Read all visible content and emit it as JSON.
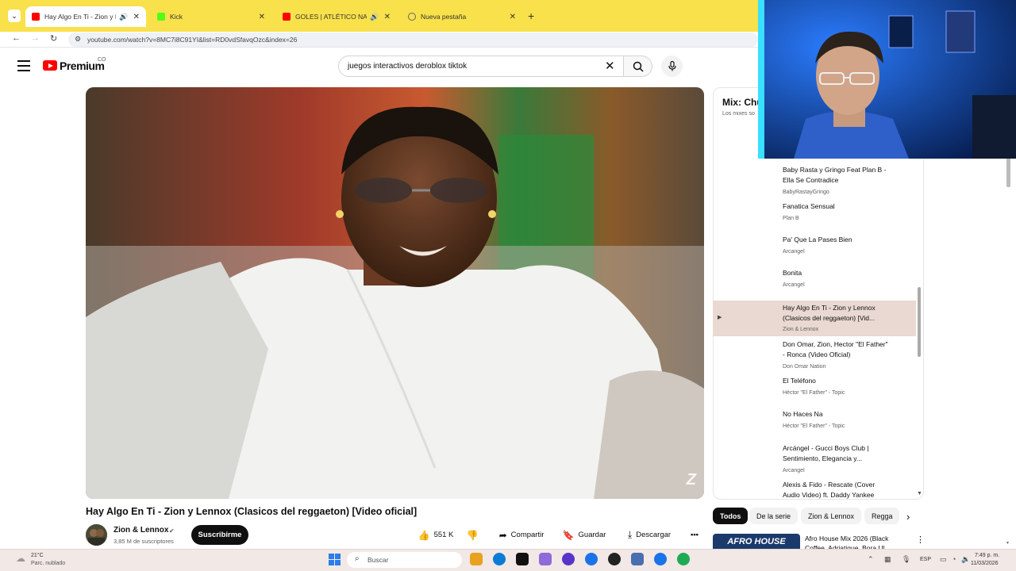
{
  "browser": {
    "tabs": [
      {
        "title": "Hay Algo En Ti - Zion y Len",
        "active": true,
        "favicon_color": "#ff0000"
      },
      {
        "title": "Kick",
        "active": false,
        "favicon_color": "#53fc18"
      },
      {
        "title": "GOLES | ATLÉTICO NACION",
        "active": false,
        "favicon_color": "#ff0000"
      },
      {
        "title": "Nueva pestaña",
        "active": false
      }
    ],
    "url": "youtube.com/watch?v=8MC7i8C91YI&list=RD0vdSfavqOzc&index=26"
  },
  "youtube": {
    "brand": "Premium",
    "country": "CO",
    "search_query": "juegos interactivos deroblox  tiktok"
  },
  "video": {
    "title": "Hay Algo En Ti - Zion y Lennox (Clasicos del reggaeton) [Video oficial]",
    "channel": "Zion & Lennox",
    "subscribers": "3,85 M de suscriptores",
    "subscribe_label": "Suscribirme",
    "likes": "551 K",
    "share_label": "Compartir",
    "save_label": "Guardar",
    "download_label": "Descargar"
  },
  "mix": {
    "title": "Mix: Chu",
    "subtitle": "Los mixes so"
  },
  "playlist": [
    {
      "title": "Baby Rasta y Gringo Feat Plan B - Ella Se Contradice",
      "channel": "BabyRastayGringo",
      "active": false
    },
    {
      "title": "Fanatica Sensual",
      "channel": "Plan B",
      "active": false
    },
    {
      "title": "Pa' Que La Pases Bien",
      "channel": "Arcangel",
      "active": false
    },
    {
      "title": "Bonita",
      "channel": "Arcangel",
      "active": false
    },
    {
      "title": "Hay Algo En Ti - Zion y Lennox (Clasicos del reggaeton) [Vid...",
      "channel": "Zion & Lennox",
      "active": true,
      "indicator": "▶"
    },
    {
      "title": "Don Omar, Zion, Hector \"El Father\" - Ronca (Video Oficial)",
      "channel": "Don Omar Nation",
      "active": false
    },
    {
      "title": "El Teléfono",
      "channel": "Héctor \"El Father\" - Topic",
      "active": false
    },
    {
      "title": "No Haces Na",
      "channel": "Héctor \"El Father\" - Topic",
      "active": false
    },
    {
      "title": "Arcángel - Gucci Boys Club | Sentimiento, Elegancia y...",
      "channel": "Arcangel",
      "active": false
    },
    {
      "title": "Alexis & Fido - Rescate (Cover Audio Video) ft. Daddy Yankee",
      "channel": "",
      "active": false
    }
  ],
  "chips": [
    "Todos",
    "De la serie",
    "Zion & Lennox",
    "Regga"
  ],
  "recommendation": {
    "thumb_text": "AFRO HOUSE",
    "title": "Afro House Mix 2026 (Black Coffee, Adriatique, Bora Ul..."
  },
  "taskbar": {
    "temperature": "21°C",
    "weather": "Parc. nublado",
    "search_placeholder": "Buscar",
    "language": "ESP",
    "time": "7:49 p. m.",
    "date": "11/03/2026",
    "app_colors": [
      "#e8a21f",
      "#0a7cd4",
      "#111111",
      "#8d6bd8",
      "#5a34c8",
      "#1a73e8",
      "#222222",
      "#4a6fb0",
      "#1a73e8",
      "#1faa55"
    ]
  }
}
